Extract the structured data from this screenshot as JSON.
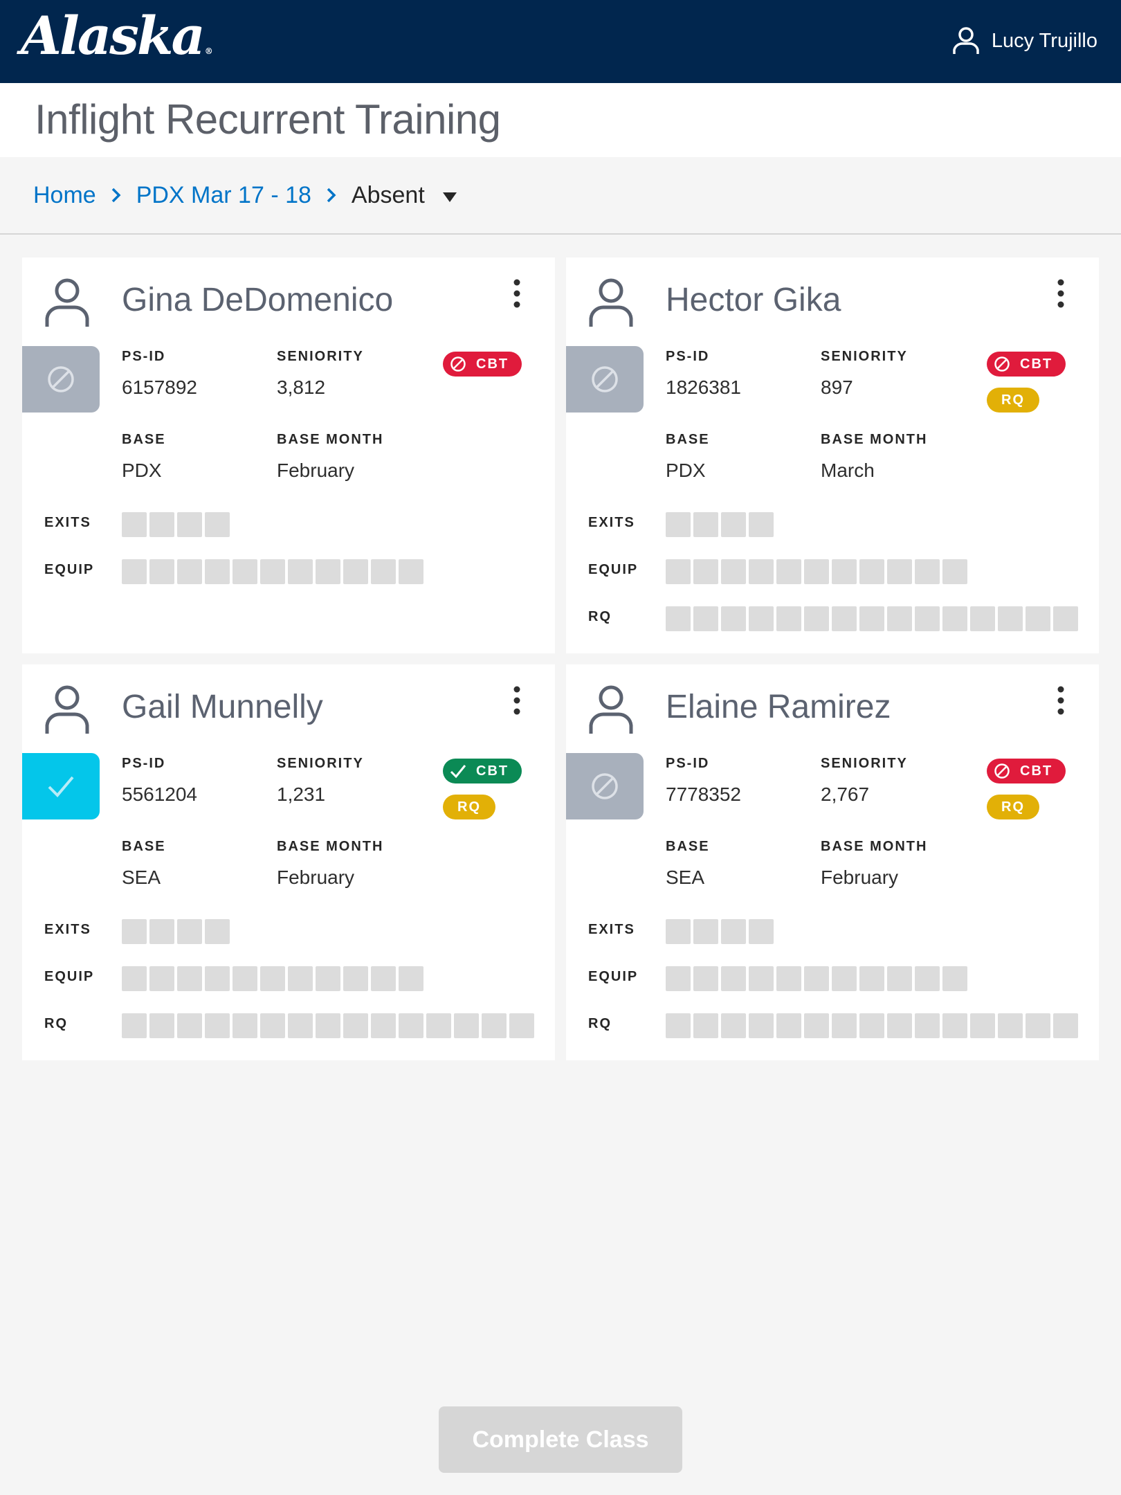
{
  "header": {
    "logo_text": "Alaska",
    "logo_mark": "®",
    "user_name": "Lucy Trujillo"
  },
  "page_title": "Inflight Recurrent Training",
  "breadcrumb": {
    "home": "Home",
    "class": "PDX Mar 17 - 18",
    "filter": "Absent"
  },
  "labels": {
    "ps_id": "PS-ID",
    "seniority": "SENIORITY",
    "base": "BASE",
    "base_month": "BASE MONTH",
    "exits": "EXITS",
    "equip": "EQUIP",
    "rq": "RQ",
    "cbt": "CBT"
  },
  "cards": [
    {
      "name": "Gina DeDomenico",
      "ps_id": "6157892",
      "seniority": "3,812",
      "base": "PDX",
      "base_month": "February",
      "status": "absent",
      "cbt_status": "incomplete",
      "rq_badge": false,
      "exits_count": 4,
      "equip_count": 11,
      "rq_count": 0
    },
    {
      "name": "Hector Gika",
      "ps_id": "1826381",
      "seniority": "897",
      "base": "PDX",
      "base_month": "March",
      "status": "absent",
      "cbt_status": "incomplete",
      "rq_badge": true,
      "exits_count": 4,
      "equip_count": 11,
      "rq_count": 15
    },
    {
      "name": "Gail Munnelly",
      "ps_id": "5561204",
      "seniority": "1,231",
      "base": "SEA",
      "base_month": "February",
      "status": "present",
      "cbt_status": "complete",
      "rq_badge": true,
      "exits_count": 4,
      "equip_count": 11,
      "rq_count": 15
    },
    {
      "name": "Elaine Ramirez",
      "ps_id": "7778352",
      "seniority": "2,767",
      "base": "SEA",
      "base_month": "February",
      "status": "absent",
      "cbt_status": "incomplete",
      "rq_badge": true,
      "exits_count": 4,
      "equip_count": 11,
      "rq_count": 15
    }
  ],
  "footer": {
    "complete_label": "Complete Class"
  },
  "colors": {
    "navy": "#01264e",
    "link": "#0074c8",
    "cbt_incomplete": "#e01b3c",
    "cbt_complete": "#0b8a55",
    "rq": "#e2b007",
    "present": "#04c6ea",
    "absent": "#a8b0bc"
  }
}
